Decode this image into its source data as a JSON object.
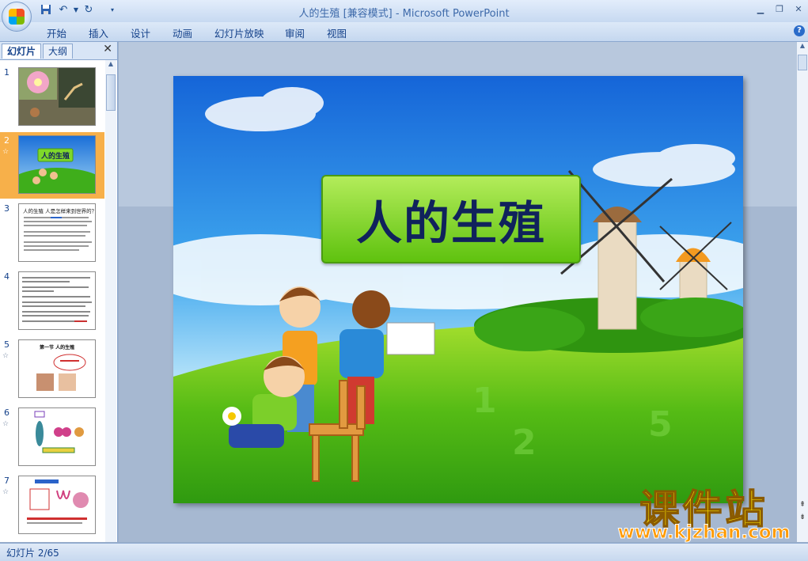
{
  "app": {
    "title": "人的生殖 [兼容模式] - Microsoft PowerPoint"
  },
  "ribbon": {
    "tabs": [
      "开始",
      "插入",
      "设计",
      "动画",
      "幻灯片放映",
      "审阅",
      "视图"
    ]
  },
  "panel": {
    "tab_slides": "幻灯片",
    "tab_outline": "大纲",
    "close": "✕"
  },
  "slides": [
    {
      "num": "1",
      "star": ""
    },
    {
      "num": "2",
      "star": "☆",
      "title": "人的生殖"
    },
    {
      "num": "3",
      "star": "",
      "text": "人的生殖 人是怎样来到世界的？"
    },
    {
      "num": "4",
      "star": ""
    },
    {
      "num": "5",
      "star": "☆",
      "text": "第一节 人的生殖"
    },
    {
      "num": "6",
      "star": "☆"
    },
    {
      "num": "7",
      "star": "☆"
    }
  ],
  "current_slide": {
    "title": "人的生殖"
  },
  "watermark": {
    "cn": "课件站",
    "url": "www.kjzhan.com"
  },
  "status": {
    "text": "幻灯片 2/65"
  }
}
